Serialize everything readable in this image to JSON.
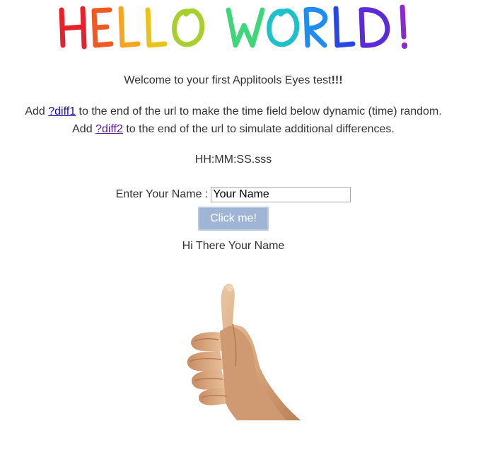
{
  "header": {
    "banner_text": "HELLO WORLD!",
    "banner_colors": [
      "#e8202c",
      "#f05a22",
      "#f7a51c",
      "#f3e11a",
      "#3ed67a",
      "#1ec0c9",
      "#1f8df0",
      "#2747e6",
      "#5a2bd6",
      "#8b2ad1"
    ]
  },
  "intro": {
    "welcome_text": "Welcome to your first Applitools Eyes test",
    "welcome_emphasis": "!!!",
    "diff1_prefix": "Add ",
    "diff1_link": "?diff1",
    "diff1_suffix": " to the end of the url to make the time field below dynamic (time) random.",
    "diff2_prefix": "Add ",
    "diff2_link": "?diff2",
    "diff2_suffix": " to the end of the url to simulate additional differences."
  },
  "time_display": "HH:MM:SS.sss",
  "form": {
    "name_label": "Enter Your Name : ",
    "name_value": "Your Name",
    "button_label": "Click me!",
    "greeting": "Hi There Your Name"
  },
  "image": {
    "icon": "thumbs-up-hand"
  },
  "colors": {
    "link": "#1a0dab",
    "link_visited": "#551a8b",
    "button_bg": "#9fb5d6"
  }
}
